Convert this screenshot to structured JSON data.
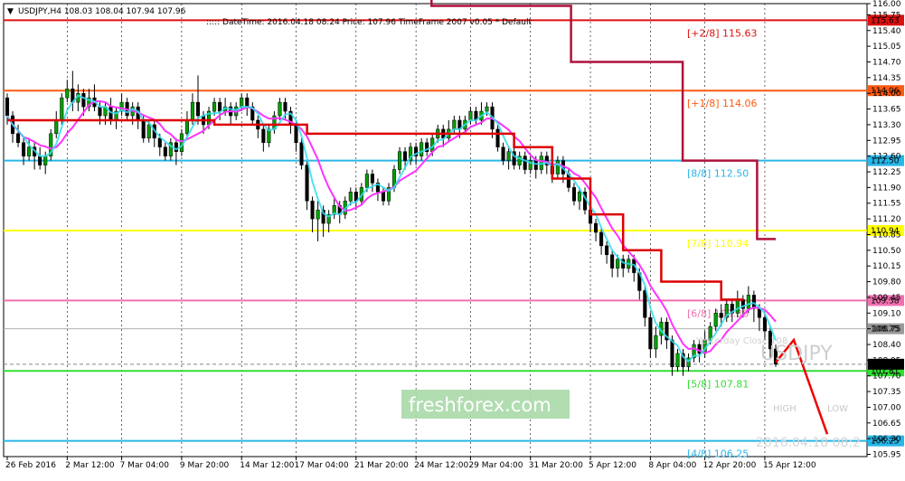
{
  "header": {
    "symbol_line": "USDJPY,H4  108.03 108.04 107.94 107.96",
    "info_line": "::::: DateTime: 2016.04.18 08:24   Price: 107.96   TimeFrame 2007 v0.05   *   Default"
  },
  "watermark": {
    "symbol": "USDJPY",
    "brand": "freshforex.com",
    "high_label": "HIGH",
    "low_label": "LOW",
    "datetime": "2016.04.18 08:2",
    "yesterday_close": "Yesterday Close 108"
  },
  "chart_data": {
    "type": "candlestick",
    "symbol": "USDJPY",
    "timeframe": "H4",
    "ohlc_last": {
      "open": 108.03,
      "high": 108.04,
      "low": 107.94,
      "close": 107.96
    },
    "ylim": [
      105.9,
      116.0
    ],
    "y_ticks": [
      "116.00",
      "115.75",
      "115.40",
      "115.05",
      "114.70",
      "114.35",
      "114.00",
      "113.65",
      "113.30",
      "112.95",
      "112.60",
      "112.25",
      "111.90",
      "111.55",
      "111.20",
      "110.85",
      "110.50",
      "110.15",
      "109.80",
      "109.45",
      "109.10",
      "108.75",
      "108.40",
      "108.05",
      "107.70",
      "107.35",
      "107.00",
      "106.65",
      "106.30",
      "105.95"
    ],
    "x_ticks": [
      "26 Feb 2016",
      "2 Mar 12:00",
      "7 Mar 04:00",
      "9 Mar 20:00",
      "14 Mar 12:00",
      "17 Mar 04:00",
      "21 Mar 20:00",
      "24 Mar 12:00",
      "29 Mar 04:00",
      "31 Mar 20:00",
      "5 Apr 12:00",
      "8 Apr 04:00",
      "12 Apr 20:00",
      "15 Apr 12:00"
    ],
    "current_price": 107.96,
    "current_price_label": "107.96",
    "close_level": {
      "value": 108.75,
      "label": "108.75"
    },
    "levels": [
      {
        "value": 115.63,
        "label": "[+2/8]   115.63",
        "axis": "115.63",
        "color": "#dd1010"
      },
      {
        "value": 114.06,
        "label": "[+1/8]   114.06",
        "axis": "114.06",
        "color": "#ff5a10"
      },
      {
        "value": 112.5,
        "label": "[8/8]     112.50",
        "axis": "112.50",
        "color": "#29b6e8"
      },
      {
        "value": 110.94,
        "label": "[7/8]     110.94",
        "axis": "110.94",
        "color": "#ffff00"
      },
      {
        "value": 109.38,
        "label": "[6/8]     109.38",
        "axis": "109.38",
        "color": "#f070b0"
      },
      {
        "value": 107.81,
        "label": "[5/8]     107.81",
        "axis": "107.81",
        "color": "#33dd33"
      },
      {
        "value": 106.25,
        "label": "[4/8]     106.25",
        "axis": "106.25",
        "color": "#29b6e8"
      }
    ],
    "candles": [
      [
        113.9,
        113.5,
        114.0,
        113.3
      ],
      [
        113.5,
        113.1,
        113.6,
        112.9
      ],
      [
        113.1,
        112.9,
        113.3,
        112.8
      ],
      [
        112.9,
        112.6,
        113.0,
        112.4
      ],
      [
        112.6,
        112.8,
        113.0,
        112.5
      ],
      [
        112.8,
        112.6,
        112.9,
        112.3
      ],
      [
        112.6,
        112.4,
        112.8,
        112.3
      ],
      [
        112.4,
        112.6,
        112.7,
        112.2
      ],
      [
        112.6,
        113.1,
        113.2,
        112.5
      ],
      [
        113.1,
        113.4,
        113.6,
        113.0
      ],
      [
        113.4,
        113.9,
        114.0,
        113.3
      ],
      [
        113.9,
        114.1,
        114.3,
        113.8
      ],
      [
        114.1,
        113.8,
        114.5,
        113.6
      ],
      [
        113.8,
        114.0,
        114.2,
        113.6
      ],
      [
        114.0,
        113.7,
        114.1,
        113.5
      ],
      [
        113.7,
        113.9,
        114.1,
        113.6
      ],
      [
        113.9,
        113.7,
        114.2,
        113.6
      ],
      [
        113.7,
        113.5,
        113.8,
        113.3
      ],
      [
        113.5,
        113.7,
        113.8,
        113.3
      ],
      [
        113.7,
        113.4,
        113.9,
        113.3
      ],
      [
        113.4,
        113.6,
        113.7,
        113.2
      ],
      [
        113.6,
        113.8,
        114.0,
        113.5
      ],
      [
        113.8,
        113.5,
        113.9,
        113.4
      ],
      [
        113.5,
        113.7,
        113.8,
        113.3
      ],
      [
        113.7,
        113.4,
        113.8,
        113.2
      ],
      [
        113.4,
        113.0,
        113.5,
        112.9
      ],
      [
        113.0,
        113.3,
        113.4,
        112.9
      ],
      [
        113.3,
        113.0,
        113.4,
        112.8
      ],
      [
        113.0,
        112.8,
        113.1,
        112.6
      ],
      [
        112.8,
        112.6,
        112.9,
        112.5
      ],
      [
        112.6,
        112.9,
        113.0,
        112.5
      ],
      [
        112.9,
        112.7,
        113.0,
        112.4
      ],
      [
        112.7,
        113.1,
        113.2,
        112.6
      ],
      [
        113.1,
        113.4,
        113.6,
        113.0
      ],
      [
        113.4,
        113.8,
        114.0,
        113.3
      ],
      [
        113.8,
        113.5,
        114.4,
        113.3
      ],
      [
        113.5,
        113.3,
        113.6,
        113.1
      ],
      [
        113.3,
        113.6,
        113.7,
        113.2
      ],
      [
        113.6,
        113.8,
        113.9,
        113.5
      ],
      [
        113.8,
        113.6,
        113.9,
        113.4
      ],
      [
        113.6,
        113.7,
        113.9,
        113.5
      ],
      [
        113.7,
        113.5,
        113.8,
        113.3
      ],
      [
        113.5,
        113.7,
        113.8,
        113.4
      ],
      [
        113.7,
        113.9,
        114.0,
        113.6
      ],
      [
        113.9,
        113.7,
        114.0,
        113.5
      ],
      [
        113.7,
        113.4,
        113.8,
        113.3
      ],
      [
        113.4,
        113.2,
        113.5,
        113.0
      ],
      [
        113.2,
        112.9,
        113.3,
        112.7
      ],
      [
        112.9,
        113.2,
        113.3,
        112.8
      ],
      [
        113.2,
        113.5,
        113.6,
        113.1
      ],
      [
        113.5,
        113.8,
        113.9,
        113.4
      ],
      [
        113.8,
        113.6,
        113.9,
        113.4
      ],
      [
        113.6,
        113.3,
        113.7,
        113.1
      ],
      [
        113.3,
        112.9,
        113.4,
        112.7
      ],
      [
        112.9,
        112.4,
        113.0,
        112.3
      ],
      [
        112.4,
        111.6,
        112.5,
        111.4
      ],
      [
        111.6,
        111.2,
        111.7,
        110.9
      ],
      [
        111.2,
        111.4,
        111.6,
        110.7
      ],
      [
        111.4,
        111.1,
        111.5,
        110.8
      ],
      [
        111.1,
        111.3,
        111.4,
        110.9
      ],
      [
        111.3,
        111.5,
        111.7,
        111.2
      ],
      [
        111.5,
        111.3,
        111.6,
        111.1
      ],
      [
        111.3,
        111.6,
        111.7,
        111.2
      ],
      [
        111.6,
        111.8,
        111.9,
        111.5
      ],
      [
        111.8,
        111.6,
        111.9,
        111.4
      ],
      [
        111.6,
        111.9,
        112.0,
        111.5
      ],
      [
        111.9,
        112.2,
        112.3,
        111.8
      ],
      [
        112.2,
        112.0,
        112.3,
        111.8
      ],
      [
        112.0,
        111.8,
        112.1,
        111.6
      ],
      [
        111.8,
        111.6,
        111.9,
        111.5
      ],
      [
        111.6,
        111.9,
        112.0,
        111.5
      ],
      [
        111.9,
        112.3,
        112.4,
        111.8
      ],
      [
        112.3,
        112.7,
        112.8,
        112.2
      ],
      [
        112.7,
        112.5,
        112.8,
        112.3
      ],
      [
        112.5,
        112.8,
        112.9,
        112.4
      ],
      [
        112.8,
        112.6,
        112.9,
        112.4
      ],
      [
        112.6,
        112.9,
        113.0,
        112.5
      ],
      [
        112.9,
        112.7,
        113.0,
        112.6
      ],
      [
        112.7,
        113.0,
        113.1,
        112.6
      ],
      [
        113.0,
        113.2,
        113.3,
        112.9
      ],
      [
        113.2,
        113.0,
        113.3,
        112.8
      ],
      [
        113.0,
        113.2,
        113.4,
        112.9
      ],
      [
        113.2,
        113.4,
        113.5,
        113.1
      ],
      [
        113.4,
        113.2,
        113.5,
        113.0
      ],
      [
        113.2,
        113.4,
        113.5,
        113.1
      ],
      [
        113.4,
        113.6,
        113.7,
        113.3
      ],
      [
        113.6,
        113.4,
        113.7,
        113.3
      ],
      [
        113.4,
        113.6,
        113.8,
        113.3
      ],
      [
        113.6,
        113.7,
        113.8,
        113.5
      ],
      [
        113.7,
        113.2,
        113.8,
        113.0
      ],
      [
        113.2,
        112.8,
        113.3,
        112.7
      ],
      [
        112.8,
        112.5,
        112.9,
        112.4
      ],
      [
        112.5,
        112.7,
        112.8,
        112.3
      ],
      [
        112.7,
        112.4,
        112.8,
        112.3
      ],
      [
        112.4,
        112.6,
        112.7,
        112.3
      ],
      [
        112.6,
        112.3,
        112.7,
        112.2
      ],
      [
        112.3,
        112.5,
        112.6,
        112.2
      ],
      [
        112.5,
        112.3,
        112.6,
        112.1
      ],
      [
        112.3,
        112.6,
        112.7,
        112.2
      ],
      [
        112.6,
        112.4,
        112.7,
        112.2
      ],
      [
        112.4,
        112.2,
        112.5,
        112.0
      ],
      [
        112.2,
        112.5,
        112.6,
        112.1
      ],
      [
        112.5,
        112.2,
        112.6,
        112.0
      ],
      [
        112.2,
        111.9,
        112.3,
        111.8
      ],
      [
        111.9,
        111.6,
        112.0,
        111.5
      ],
      [
        111.6,
        111.8,
        111.9,
        111.4
      ],
      [
        111.8,
        111.4,
        111.9,
        111.3
      ],
      [
        111.4,
        111.1,
        111.5,
        110.9
      ],
      [
        111.1,
        110.9,
        111.2,
        110.7
      ],
      [
        110.9,
        110.6,
        111.0,
        110.4
      ],
      [
        110.6,
        110.4,
        110.7,
        110.2
      ],
      [
        110.4,
        110.1,
        110.5,
        109.9
      ],
      [
        110.1,
        110.3,
        110.4,
        109.9
      ],
      [
        110.3,
        110.1,
        110.4,
        109.9
      ],
      [
        110.1,
        110.3,
        110.4,
        110.0
      ],
      [
        110.3,
        110.0,
        110.4,
        109.8
      ],
      [
        110.0,
        109.6,
        110.1,
        109.4
      ],
      [
        109.6,
        109.0,
        109.7,
        108.8
      ],
      [
        109.0,
        108.3,
        109.1,
        108.1
      ],
      [
        108.3,
        108.6,
        108.8,
        108.1
      ],
      [
        108.6,
        108.9,
        109.0,
        108.4
      ],
      [
        108.9,
        108.5,
        109.0,
        108.3
      ],
      [
        108.5,
        107.9,
        108.6,
        107.7
      ],
      [
        107.9,
        108.2,
        108.3,
        107.8
      ],
      [
        108.2,
        107.9,
        108.3,
        107.7
      ],
      [
        107.9,
        108.1,
        108.2,
        107.8
      ],
      [
        108.1,
        108.4,
        108.5,
        108.0
      ],
      [
        108.4,
        108.2,
        108.5,
        108.0
      ],
      [
        108.2,
        108.5,
        108.7,
        108.1
      ],
      [
        108.5,
        108.8,
        108.9,
        108.4
      ],
      [
        108.8,
        109.1,
        109.2,
        108.7
      ],
      [
        109.1,
        109.0,
        109.3,
        108.8
      ],
      [
        109.0,
        109.3,
        109.4,
        108.9
      ],
      [
        109.3,
        109.1,
        109.4,
        108.9
      ],
      [
        109.1,
        109.4,
        109.6,
        109.0
      ],
      [
        109.4,
        109.2,
        109.5,
        109.0
      ],
      [
        109.2,
        109.5,
        109.7,
        109.1
      ],
      [
        109.5,
        109.2,
        109.6,
        108.9
      ],
      [
        109.2,
        109.0,
        109.3,
        108.7
      ],
      [
        109.0,
        108.7,
        109.1,
        108.5
      ],
      [
        108.7,
        108.3,
        108.8,
        108.1
      ],
      [
        108.3,
        107.96,
        108.4,
        107.9
      ]
    ],
    "trend_red": [
      [
        0,
        113.4
      ],
      [
        38,
        113.4
      ],
      [
        38,
        113.3
      ],
      [
        55,
        113.3
      ],
      [
        55,
        113.1
      ],
      [
        93,
        113.1
      ],
      [
        93,
        112.8
      ],
      [
        100,
        112.8
      ],
      [
        100,
        112.1
      ],
      [
        107,
        112.1
      ],
      [
        107,
        111.3
      ],
      [
        113,
        111.3
      ],
      [
        113,
        110.5
      ],
      [
        120,
        110.5
      ],
      [
        120,
        109.8
      ],
      [
        131,
        109.8
      ],
      [
        131,
        109.4
      ],
      [
        135,
        109.4
      ]
    ],
    "annotation_arrow": {
      "from_idx": 136,
      "note": "red projection down to 106.25"
    }
  }
}
